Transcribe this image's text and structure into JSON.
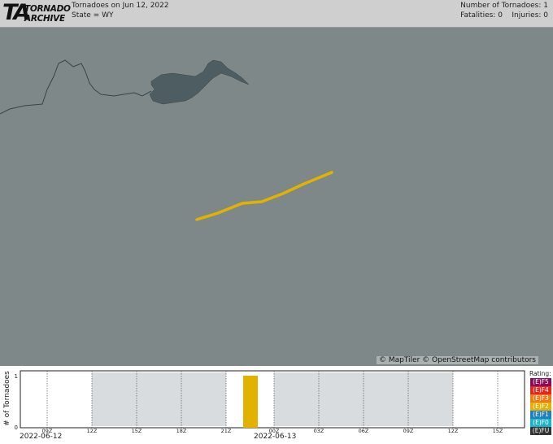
{
  "header": {
    "logo_line1": "TORNADO",
    "logo_line2": "ARCHIVE",
    "logo_mark": "TA",
    "title": "Tornadoes on Jun 12, 2022",
    "subtitle": "State = WY",
    "count_label": "Number of Tornadoes: 1",
    "fatalities_label": "Fatalities: 0",
    "injuries_label": "Injuries: 0"
  },
  "map": {
    "attribution": "© MapTiler © OpenStreetMap contributors",
    "background_color": "#7f8888",
    "water_color": "#4d5d61",
    "track_color": "#e3b200"
  },
  "timeline": {
    "ylabel": "# of Tornadoes",
    "ytick_max": "1",
    "ytick_min": "0",
    "hour_ticks": [
      "09Z",
      "12Z",
      "15Z",
      "18Z",
      "21Z",
      "00Z",
      "03Z",
      "06Z",
      "09Z",
      "12Z",
      "15Z"
    ],
    "date_left": "2022-06-12",
    "date_right": "2022-06-13",
    "legend_title": "Rating:",
    "legend": [
      {
        "label": "(E)F5",
        "color": "#8b0a5a"
      },
      {
        "label": "(E)F4",
        "color": "#e2261b"
      },
      {
        "label": "(E)F3",
        "color": "#f07b19"
      },
      {
        "label": "(E)F2",
        "color": "#e3b200"
      },
      {
        "label": "(E)F1",
        "color": "#1f7fbf"
      },
      {
        "label": "(E)F0",
        "color": "#1ab3c8"
      },
      {
        "label": "(E)FU",
        "color": "#333333"
      }
    ]
  }
}
